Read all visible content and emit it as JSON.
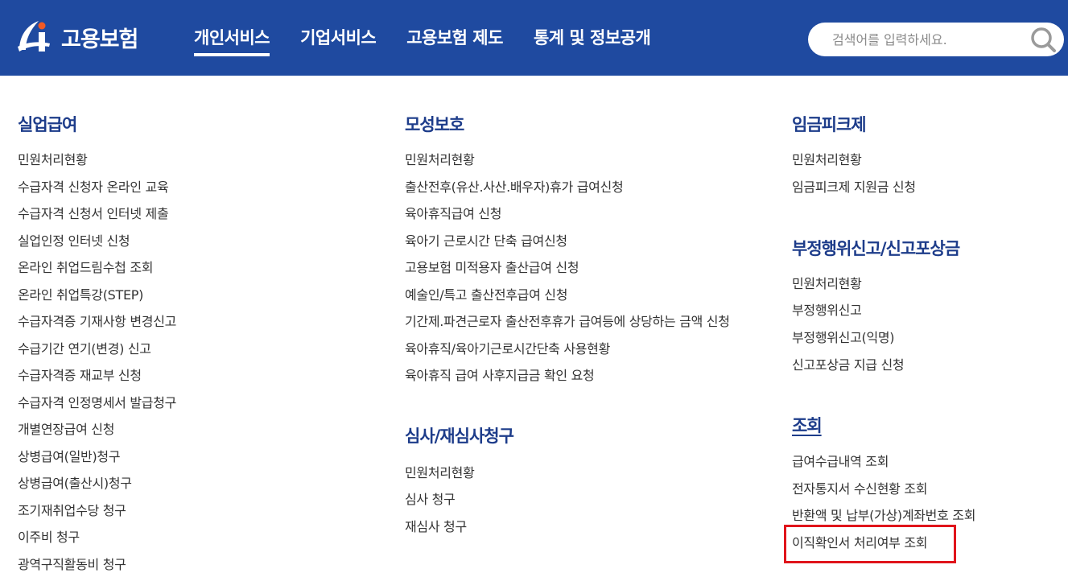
{
  "header": {
    "logo_text": "고용보험",
    "nav": [
      "개인서비스",
      "기업서비스",
      "고용보험 제도",
      "통계 및 정보공개"
    ],
    "search_placeholder": "검색어를 입력하세요."
  },
  "colors": {
    "header_bg": "#1f4aa0",
    "section_title": "#1d3c8a",
    "highlight": "#e0141b"
  },
  "icons": {
    "logo": "ei-logo-icon",
    "search": "search-icon"
  },
  "sections": {
    "unemployment": {
      "title": "실업급여",
      "items": [
        "민원처리현황",
        "수급자격 신청자 온라인 교육",
        "수급자격 신청서 인터넷 제출",
        "실업인정 인터넷 신청",
        "온라인 취업드림수첩 조회",
        "온라인 취업특강(STEP)",
        "수급자격증 기재사항 변경신고",
        "수급기간 연기(변경) 신고",
        "수급자격증 재교부 신청",
        "수급자격 인정명세서 발급청구",
        "개별연장급여 신청",
        "상병급여(일반)청구",
        "상병급여(출산시)청구",
        "조기재취업수당 청구",
        "이주비 청구",
        "광역구직활동비 청구"
      ]
    },
    "maternity": {
      "title": "모성보호",
      "items": [
        "민원처리현황",
        "출산전후(유산.사산.배우자)휴가 급여신청",
        "육아휴직급여 신청",
        "육아기 근로시간 단축 급여신청",
        "고용보험 미적용자 출산급여 신청",
        "예술인/특고 출산전후급여 신청",
        "기간제.파견근로자 출산전후휴가 급여등에 상당하는 금액 신청",
        "육아휴직/육아기근로시간단축 사용현황",
        "육아휴직 급여 사후지급금 확인 요청"
      ]
    },
    "review": {
      "title": "심사/재심사청구",
      "items": [
        "민원처리현황",
        "심사 청구",
        "재심사 청구"
      ]
    },
    "wage_peak": {
      "title": "임금피크제",
      "items": [
        "민원처리현황",
        "임금피크제 지원금 신청"
      ]
    },
    "fraud": {
      "title": "부정행위신고/신고포상금",
      "items": [
        "민원처리현황",
        "부정행위신고",
        "부정행위신고(익명)",
        "신고포상금 지급 신청"
      ]
    },
    "inquiry": {
      "title": "조회",
      "items": [
        "급여수급내역 조회",
        "전자통지서 수신현황 조회",
        "반환액 및 납부(가상)계좌번호 조회",
        "이직확인서 처리여부 조회"
      ]
    }
  }
}
